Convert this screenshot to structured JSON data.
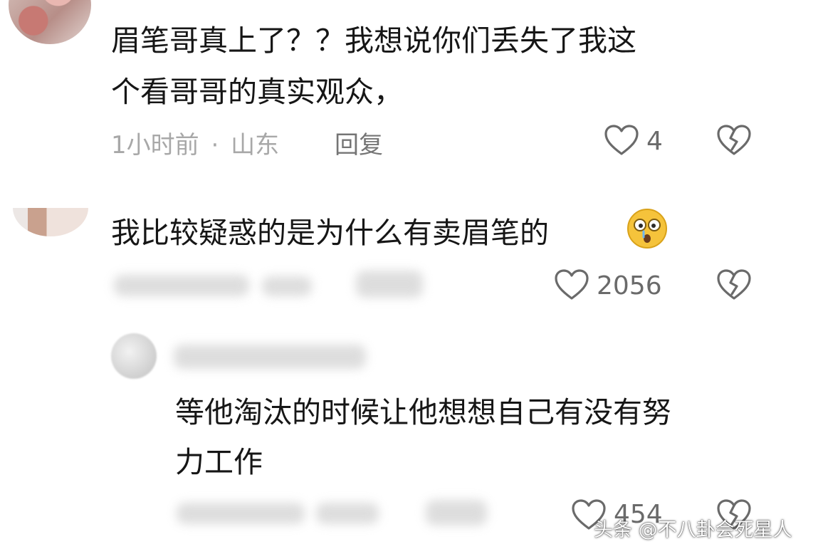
{
  "comments": [
    {
      "text_line1": "眉笔哥真上了？？我想说你们丢失了我这",
      "text_line2": "个看哥哥的真实观众，",
      "time": "1小时前",
      "separator": "·",
      "location": "山东",
      "reply_label": "回复",
      "like_count": "4"
    },
    {
      "text_line1": "我比较疑惑的是为什么有卖眉笔的",
      "like_count": "2056",
      "emoji_icon": "drooling-face-icon"
    },
    {
      "text_line1": "等他淘汰的时候让他想想自己有没有努",
      "text_line2": "力工作",
      "like_count": "454"
    }
  ],
  "watermark": "头条 @不八卦会死星人",
  "colors": {
    "text": "#161616",
    "meta": "#a8a8a8",
    "icon": "#6a6a6a"
  }
}
